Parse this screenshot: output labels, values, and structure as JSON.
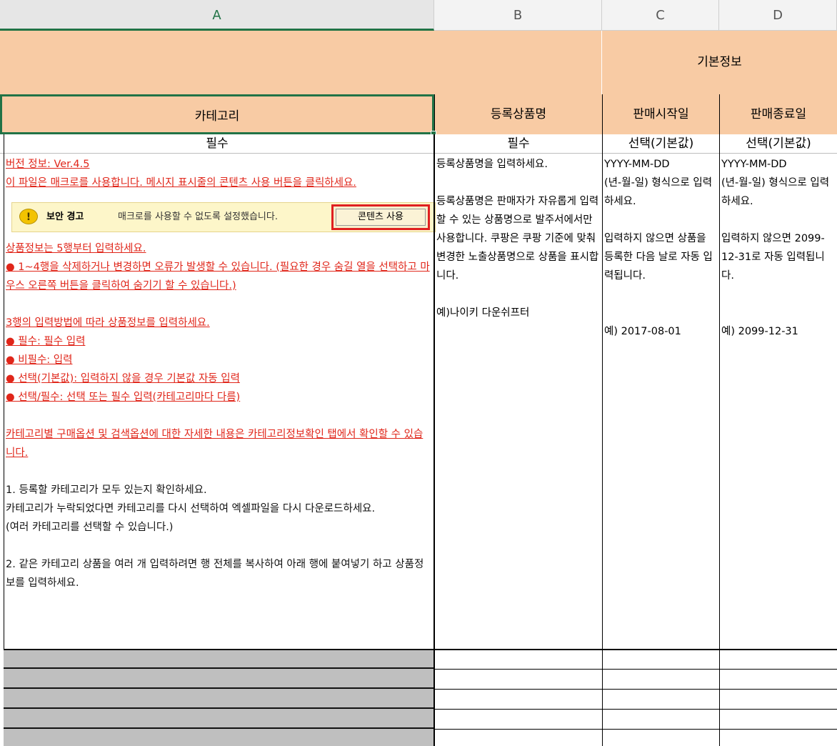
{
  "columns": [
    "A",
    "B",
    "C",
    "D"
  ],
  "group_header": "기본정보",
  "headers": {
    "a": "카테고리",
    "b": "등록상품명",
    "c": "판매시작일",
    "d": "판매종료일"
  },
  "requirements": {
    "a": "필수",
    "b": "필수",
    "c": "선택(기본값)",
    "d": "선택(기본값)"
  },
  "col_a": {
    "version": "버전 정보: Ver.4.5",
    "macro_notice": "이 파일은 매크로를 사용합니다. 메시지 표시줄의 콘텐츠 사용 버튼을 클릭하세요.",
    "security_bar": {
      "title": "보안 경고",
      "message": "매크로를 사용할 수 없도록 설정했습니다.",
      "button": "콘텐츠 사용"
    },
    "row5_notice": "상품정보는 5행부터 입력하세요.",
    "row_warning": "● 1~4행을 삭제하거나 변경하면 오류가 발생할 수 있습니다. (필요한 경우 숨길 열을 선택하고 마우스 오른쪽 버튼을 클릭하여 숨기기 할 수 있습니다.)",
    "input_intro": "3행의 입력방법에 따라 상품정보를 입력하세요.",
    "input_rules": [
      "● 필수: 필수 입력",
      "● 비필수:  입력",
      "● 선택(기본값): 입력하지 않을 경우 기본값 자동 입력",
      "● 선택/필수: 선택 또는 필수 입력(카테고리마다 다름)"
    ],
    "category_note": "카테고리별 구매옵션 및 검색옵션에 대한 자세한 내용은 카테고리정보확인 탭에서 확인할 수 있습니다.",
    "step1": [
      "1. 등록할 카테고리가 모두 있는지 확인하세요.",
      "카테고리가 누락되었다면 카테고리를 다시 선택하여 엑셀파일을 다시 다운로드하세요.",
      "(여러 카테고리를 선택할 수 있습니다.)"
    ],
    "step2": "2. 같은 카테고리 상품을 여러 개 입력하려면 행 전체를 복사하여 아래 행에 붙여넣기 하고 상품정보를 입력하세요."
  },
  "col_b": {
    "line1": "등록상품명을 입력하세요.",
    "para": "등록상품명은 판매자가 자유롭게 입력할 수 있는 상품명으로 발주서에서만 사용합니다. 쿠팡은 쿠팡 기준에 맞춰 변경한 노출상품명으로 상품을 표시합니다.",
    "example": "예)나이키 다운쉬프터"
  },
  "col_c": {
    "format1": "YYYY-MM-DD",
    "format2": "(년-월-일) 형식으로 입력하세요.",
    "para": "입력하지 않으면 상품을 등록한 다음 날로 자동 입력됩니다.",
    "example": "예) 2017-08-01"
  },
  "col_d": {
    "format1": "YYYY-MM-DD",
    "format2": "(년-월-일) 형식으로 입력하세요.",
    "para": "입력하지 않으면 2099-12-31로 자동 입력됩니다.",
    "example": "예) 2099-12-31"
  },
  "colors": {
    "header_fill": "#f8cba4",
    "warning_text": "#e0261a",
    "selection": "#217346",
    "gray_row": "#bfbfbf"
  }
}
